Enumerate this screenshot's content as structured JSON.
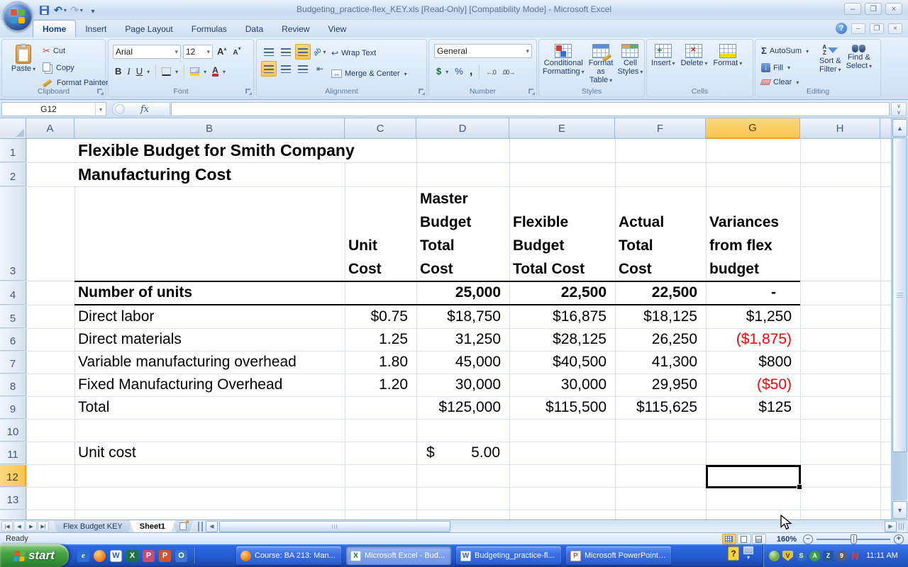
{
  "window": {
    "title": "Budgeting_practice-flex_KEY.xls  [Read-Only]  [Compatibility Mode] - Microsoft Excel"
  },
  "ribbon": {
    "tabs": [
      {
        "label": "Home"
      },
      {
        "label": "Insert"
      },
      {
        "label": "Page Layout"
      },
      {
        "label": "Formulas"
      },
      {
        "label": "Data"
      },
      {
        "label": "Review"
      },
      {
        "label": "View"
      }
    ],
    "clipboard": {
      "group": "Clipboard",
      "paste": "Paste",
      "cut": "Cut",
      "copy": "Copy",
      "format_painter": "Format Painter"
    },
    "font": {
      "group": "Font",
      "family": "Arial",
      "size": "12"
    },
    "alignment": {
      "group": "Alignment",
      "wrap": "Wrap Text",
      "merge": "Merge & Center"
    },
    "number": {
      "group": "Number",
      "format": "General"
    },
    "styles": {
      "group": "Styles",
      "conditional": "Conditional\nFormatting",
      "format_table": "Format\nas Table",
      "cell_styles": "Cell\nStyles"
    },
    "cells": {
      "group": "Cells",
      "insert": "Insert",
      "delete": "Delete",
      "format": "Format"
    },
    "editing": {
      "group": "Editing",
      "autosum": "AutoSum",
      "fill": "Fill",
      "clear": "Clear",
      "sort": "Sort &\nFilter",
      "find": "Find &\nSelect"
    }
  },
  "formula_bar": {
    "name_box": "G12",
    "formula": ""
  },
  "grid": {
    "columns": [
      "A",
      "B",
      "C",
      "D",
      "E",
      "F",
      "G",
      "H"
    ],
    "row_numbers": [
      "1",
      "2",
      "3",
      "4",
      "5",
      "6",
      "7",
      "8",
      "9",
      "10",
      "11",
      "12",
      "13"
    ],
    "title1": "Flexible Budget for Smith Company",
    "title2": "Manufacturing Cost",
    "headers": {
      "c": "Unit\nCost",
      "d": "Master\nBudget\nTotal\nCost",
      "e": "Flexible\nBudget\nTotal Cost",
      "f": "Actual\nTotal\nCost",
      "g": "Variances\nfrom flex\nbudget"
    },
    "data_rows": [
      {
        "b": "Number of units",
        "c": "",
        "d": "25,000",
        "e": "22,500",
        "f": "22,500",
        "g": "-"
      },
      {
        "b": "Direct labor",
        "c": "$0.75",
        "d": "$18,750",
        "e": "$16,875",
        "f": "$18,125",
        "g": "$1,250"
      },
      {
        "b": "Direct materials",
        "c": "1.25",
        "d": "31,250",
        "e": "$28,125",
        "f": "26,250",
        "g": "($1,875)"
      },
      {
        "b": "Variable manufacturing overhead",
        "c": "1.80",
        "d": "45,000",
        "e": "$40,500",
        "f": "41,300",
        "g": "$800"
      },
      {
        "b": "Fixed Manufacturing Overhead",
        "c": "1.20",
        "d": "30,000",
        "e": "30,000",
        "f": "29,950",
        "g": "($50)"
      },
      {
        "b": "Total",
        "c": "",
        "d": "$125,000",
        "e": "$115,500",
        "f": "$115,625",
        "g": "$125"
      }
    ],
    "unit_cost": {
      "label": "Unit cost",
      "symbol": "$",
      "value": "5.00"
    },
    "selection": {
      "cell": "G12",
      "column": "G",
      "row": "12"
    }
  },
  "sheet_tabs": {
    "tabs": [
      {
        "name": "Flex Budget KEY"
      },
      {
        "name": "Sheet1"
      }
    ]
  },
  "status_bar": {
    "ready": "Ready",
    "zoom": "160%"
  },
  "taskbar": {
    "start_label": "start",
    "tasks": [
      {
        "label": "Course: BA 213: Man...",
        "app": "firefox"
      },
      {
        "label": "Microsoft Excel - Bud...",
        "app": "excel"
      },
      {
        "label": "Budgeting_practice-fl...",
        "app": "word"
      },
      {
        "label": "Microsoft PowerPoint ...",
        "app": "powerpoint"
      }
    ],
    "clock": "11:11 AM"
  },
  "colors": {
    "negative": "#ff0000",
    "selection_highlight": "#f9c64f",
    "header_text": "#3c5a86"
  }
}
